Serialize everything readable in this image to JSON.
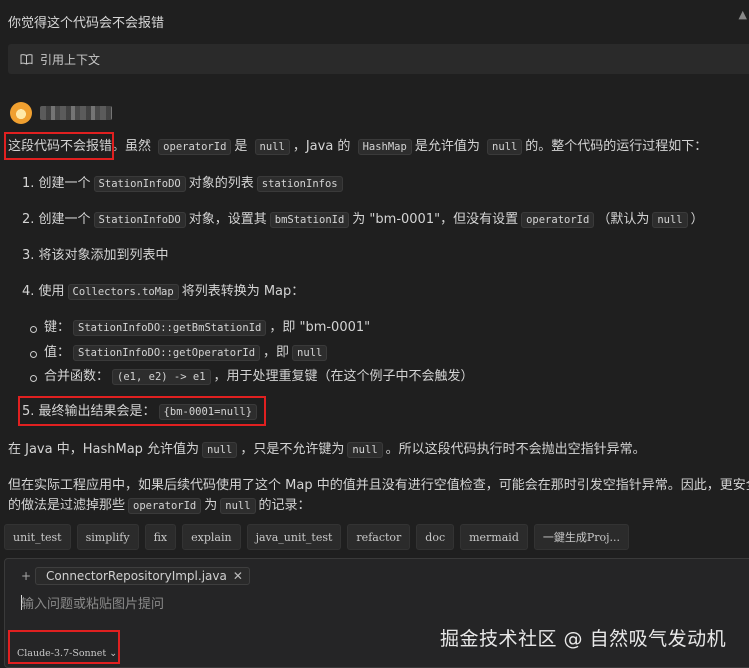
{
  "user_question": "你觉得这个代码会不会报错",
  "context_button": {
    "label": "引用上下文",
    "icon": "book-icon"
  },
  "answer": {
    "intro": {
      "boxed": "这段代码不会报错",
      "t1": "。虽然",
      "c1": "operatorId",
      "t2": "是",
      "c2": "null",
      "t3": "，Java 的",
      "c3": "HashMap",
      "t4": "是允许值为",
      "c4": "null",
      "t5": "的。整个代码的运行过程如下："
    },
    "steps": [
      {
        "prefix": "1. 创建一个",
        "c1": "StationInfoDO",
        "mid": "对象的列表",
        "c2": "stationInfos"
      },
      {
        "prefix": "2. 创建一个",
        "c1": "StationInfoDO",
        "mid": "对象，设置其",
        "c2": "bmStationId",
        "mid2": "为 \"bm-0001\"，但没有设置",
        "c3": "operatorId",
        "mid3": "（默认为",
        "c4": "null",
        "end": "）"
      },
      {
        "prefix": "3. 将该对象添加到列表中"
      },
      {
        "prefix": "4. 使用",
        "c1": "Collectors.toMap",
        "mid": "将列表转换为 Map："
      }
    ],
    "bullets": [
      {
        "label": "键：",
        "code": "StationInfoDO::getBmStationId",
        "tail": "，即 \"bm-0001\""
      },
      {
        "label": "值：",
        "code": "StationInfoDO::getOperatorId",
        "tail": "，即",
        "code2": "null"
      },
      {
        "label": "合并函数：",
        "code": "(e1, e2) -> e1",
        "tail": "，用于处理重复键（在这个例子中不会触发）"
      }
    ],
    "step5": {
      "prefix": "5. 最终输出结果会是：",
      "code": "{bm-0001=null}"
    },
    "para2": {
      "t1": "在 Java 中，HashMap 允许值为",
      "c1": "null",
      "t2": "，只是不允许键为",
      "c2": "null",
      "t3": "。所以这段代码执行时不会抛出空指针异常。"
    },
    "para3": {
      "line1": "但在实际工程应用中，如果后续代码使用了这个 Map 中的值并且没有进行空值检查，可能会在那时引发空指针异常。因此，更安全",
      "l2a": "的做法是过滤掉那些",
      "c1": "operatorId",
      "l2b": "为",
      "c2": "null",
      "l2c": "的记录："
    }
  },
  "quick_actions": [
    "unit_test",
    "simplify",
    "fix",
    "explain",
    "java_unit_test",
    "refactor",
    "doc",
    "mermaid",
    "一鍵生成Proj..."
  ],
  "input": {
    "file_chip": "ConnectorRepositoryImpl.java",
    "placeholder": "输入问题或粘贴图片提问",
    "model": "Claude-3.7-Sonnet"
  },
  "watermark": "掘金技术社区 @ 自然吸气发动机"
}
